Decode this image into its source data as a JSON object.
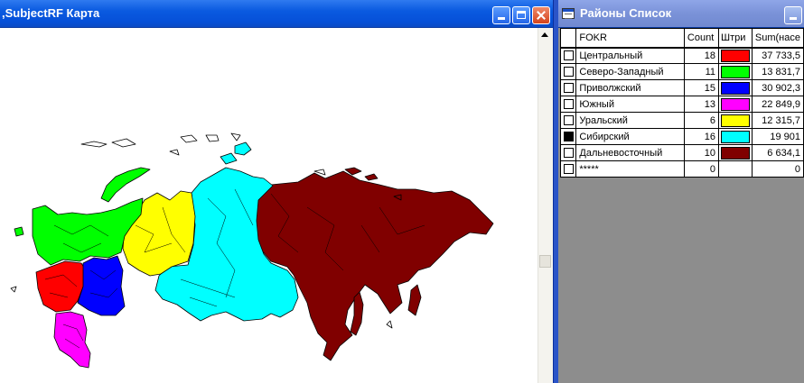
{
  "map_window": {
    "title": ",SubjectRF Карта",
    "buttons": {
      "minimize": "minimize-icon",
      "maximize": "maximize-icon",
      "close": "close-icon"
    }
  },
  "list_window": {
    "title": "Районы Список",
    "columns": [
      "FOKR",
      "Count",
      "Штри",
      "Sum(насе"
    ],
    "rows": [
      {
        "name": "Центральный",
        "count": "18",
        "color": "#ff0000",
        "sum": "37 733,5",
        "checked": false
      },
      {
        "name": "Северо-Западный",
        "count": "11",
        "color": "#00ff00",
        "sum": "13 831,7",
        "checked": false
      },
      {
        "name": "Приволжский",
        "count": "15",
        "color": "#0000ff",
        "sum": "30 902,3",
        "checked": false
      },
      {
        "name": "Южный",
        "count": "13",
        "color": "#ff00ff",
        "sum": "22 849,9",
        "checked": false
      },
      {
        "name": "Уральский",
        "count": "6",
        "color": "#ffff00",
        "sum": "12 315,7",
        "checked": false
      },
      {
        "name": "Сибирский",
        "count": "16",
        "color": "#00ffff",
        "sum": "19 901",
        "checked": true
      },
      {
        "name": "Дальневосточный",
        "count": "10",
        "color": "#800000",
        "sum": "6 634,1",
        "checked": false
      },
      {
        "name": "*****",
        "count": "0",
        "color": "",
        "sum": "0",
        "checked": false
      }
    ]
  }
}
